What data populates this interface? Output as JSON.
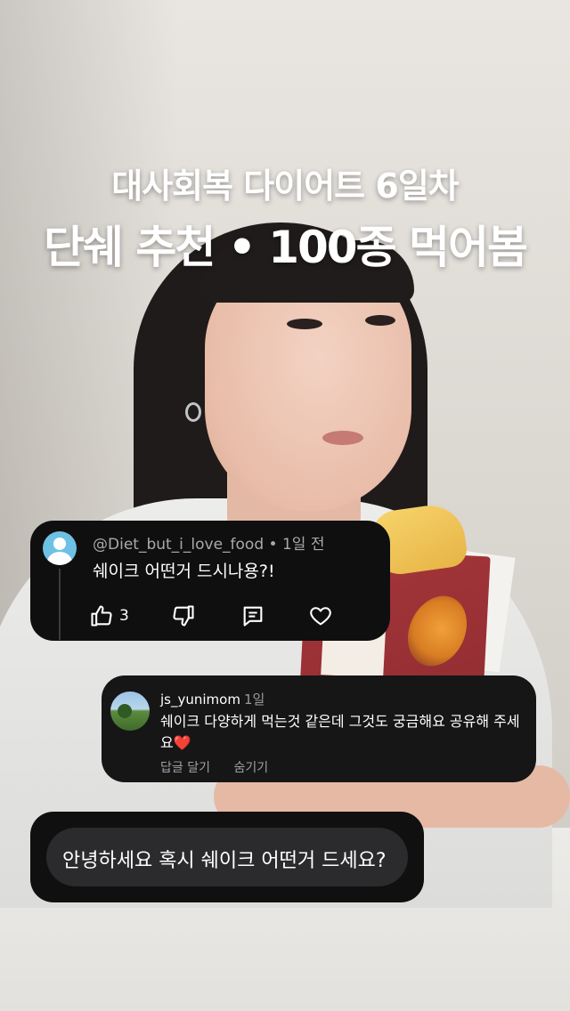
{
  "title": {
    "line1": "대사회복 다이어트 6일차",
    "line2": "단쉐 추천 • 100종 먹어봄"
  },
  "youtube_comment": {
    "username": "@Diet_but_i_love_food",
    "separator": "•",
    "time_ago": "1일 전",
    "text": "쉐이크 어떤거 드시나용?!",
    "like_count": "3",
    "icons": [
      "thumbs-up-icon",
      "thumbs-down-icon",
      "reply-icon",
      "heart-icon"
    ]
  },
  "instagram_comment": {
    "username": "js_yunimom",
    "time_ago": "1일",
    "text": "쉐이크 다양하게 먹는것 같은데 그것도 궁금해요 공유해 주세요❤️",
    "reply_label": "답글 달기",
    "hide_label": "숨기기"
  },
  "question": {
    "text": "안녕하세요 혹시 쉐이크 어떤거 드세요?"
  }
}
